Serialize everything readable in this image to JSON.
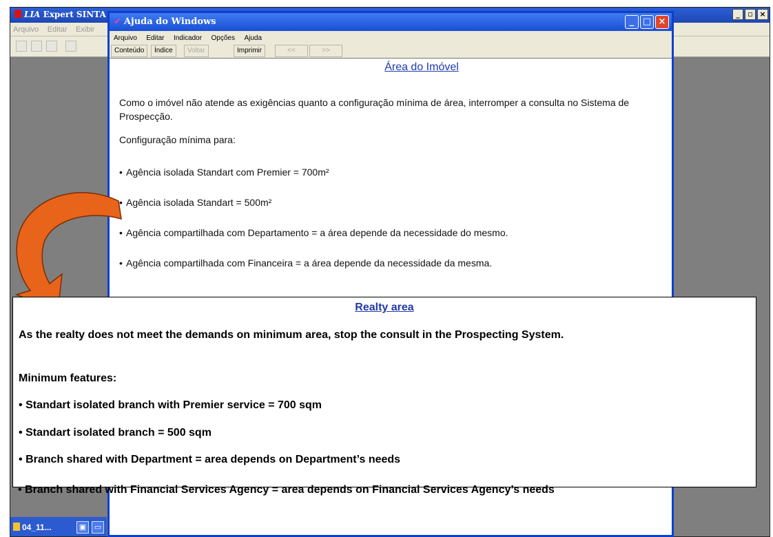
{
  "background_app": {
    "title_prefix": "LIA",
    "title_rest": "Expert SINTA",
    "menu": [
      "Arquivo",
      "Editar",
      "Exibir"
    ],
    "window_controls": [
      "_",
      "▫",
      "×"
    ],
    "taskbar_label": "04_11...",
    "taskbar_mini": [
      "▣",
      "▭"
    ]
  },
  "help_window": {
    "title": "Ajuda do Windows",
    "menu": [
      "Arquivo",
      "Editar",
      "Indicador",
      "Opções",
      "Ajuda"
    ],
    "toolbar": [
      "Conteúdo",
      "Índice",
      "Voltar",
      "Imprimir",
      "<<",
      ">>"
    ],
    "window_controls": [
      "_",
      "□",
      "×"
    ]
  },
  "portuguese_page": {
    "title": "Área do Imóvel",
    "intro": "Como o imóvel não atende as exigências quanto a configuração mínima de área, interromper a consulta no Sistema de Prospecção.",
    "subhead": "Configuração mínima para:",
    "bullets": [
      "Agência isolada Standart com Premier = 700m²",
      "Agência isolada Standart = 500m²",
      "Agência compartilhada com Departamento = a área depende da necessidade do mesmo.",
      "Agência compartilhada com Financeira = a área depende da necessidade da mesma."
    ]
  },
  "english_overlay": {
    "title": "Realty area",
    "intro": "As the realty does not meet the demands on minimum area, stop the consult in the Prospecting System.",
    "subhead": "Minimum features:",
    "bullets": [
      "Standart isolated branch with Premier service = 700 sqm",
      "Standart isolated branch = 500 sqm",
      "Branch shared with Department = area depends on Department’s needs",
      "Branch shared with Financial Services Agency = area depends on Financial Services Agency’s needs"
    ]
  },
  "bullet_glyph": "•",
  "colors": {
    "arrow_orange": "#e8641a",
    "link_blue": "#1f3aa8",
    "xp_title_blue": "#1a4fd6",
    "desktop_gray": "#7f7f7f"
  }
}
